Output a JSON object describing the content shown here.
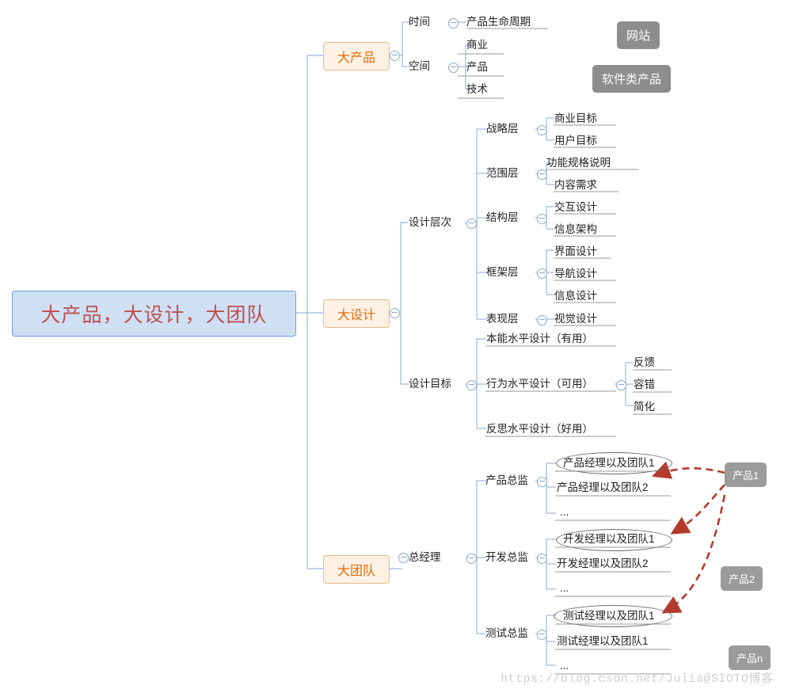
{
  "title": "大产品，大设计，大团队",
  "root": {
    "label": "大产品，大设计，大团队"
  },
  "branches": {
    "product": {
      "label": "大产品"
    },
    "design": {
      "label": "大设计"
    },
    "team": {
      "label": "大团队"
    }
  },
  "product_branch": {
    "time_label": "时间",
    "time_children": [
      "产品生命周期"
    ],
    "space_label": "空间",
    "space_children": [
      "商业",
      "产品",
      "技术"
    ]
  },
  "tags": {
    "website": "网站",
    "software": "软件类产品"
  },
  "design_branch": {
    "levels_label": "设计层次",
    "levels": [
      {
        "name": "战略层",
        "children": [
          "商业目标",
          "用户目标"
        ]
      },
      {
        "name": "范围层",
        "children": [
          "功能规格说明",
          "内容需求"
        ]
      },
      {
        "name": "结构层",
        "children": [
          "交互设计",
          "信息架构"
        ]
      },
      {
        "name": "框架层",
        "children": [
          "界面设计",
          "导航设计",
          "信息设计"
        ]
      },
      {
        "name": "表现层",
        "children": [
          "视觉设计"
        ]
      }
    ],
    "goals_label": "设计目标",
    "goals": [
      {
        "name": "本能水平设计（有用）",
        "children": []
      },
      {
        "name": "行为水平设计（可用）",
        "children": [
          "反馈",
          "容错",
          "简化"
        ]
      },
      {
        "name": "反思水平设计（好用）",
        "children": []
      }
    ]
  },
  "team_branch": {
    "gm_label": "总经理",
    "directors": [
      {
        "name": "产品总监",
        "members": [
          "产品经理以及团队1",
          "产品经理以及团队2",
          "..."
        ]
      },
      {
        "name": "开发总监",
        "members": [
          "开发经理以及团队1",
          "开发经理以及团队2",
          "..."
        ]
      },
      {
        "name": "测试总监",
        "members": [
          "测试经理以及团队1",
          "测试经理以及团队1",
          "..."
        ]
      }
    ],
    "products": [
      "产品1",
      "产品2",
      "产品n"
    ]
  },
  "watermark": "https://blog.csdn.net/Julia@SIOTO博客",
  "colors": {
    "root_fill": "#cfe0f5",
    "root_border": "#6f9fd8",
    "root_text": "#c0504d",
    "l1_fill": "#fdf1e4",
    "l1_border": "#e8b98a",
    "l1_text": "#e36c0a",
    "tag_fill": "#8d8d8d",
    "line": "#9fb8d4",
    "arrow": "#c0392b"
  }
}
